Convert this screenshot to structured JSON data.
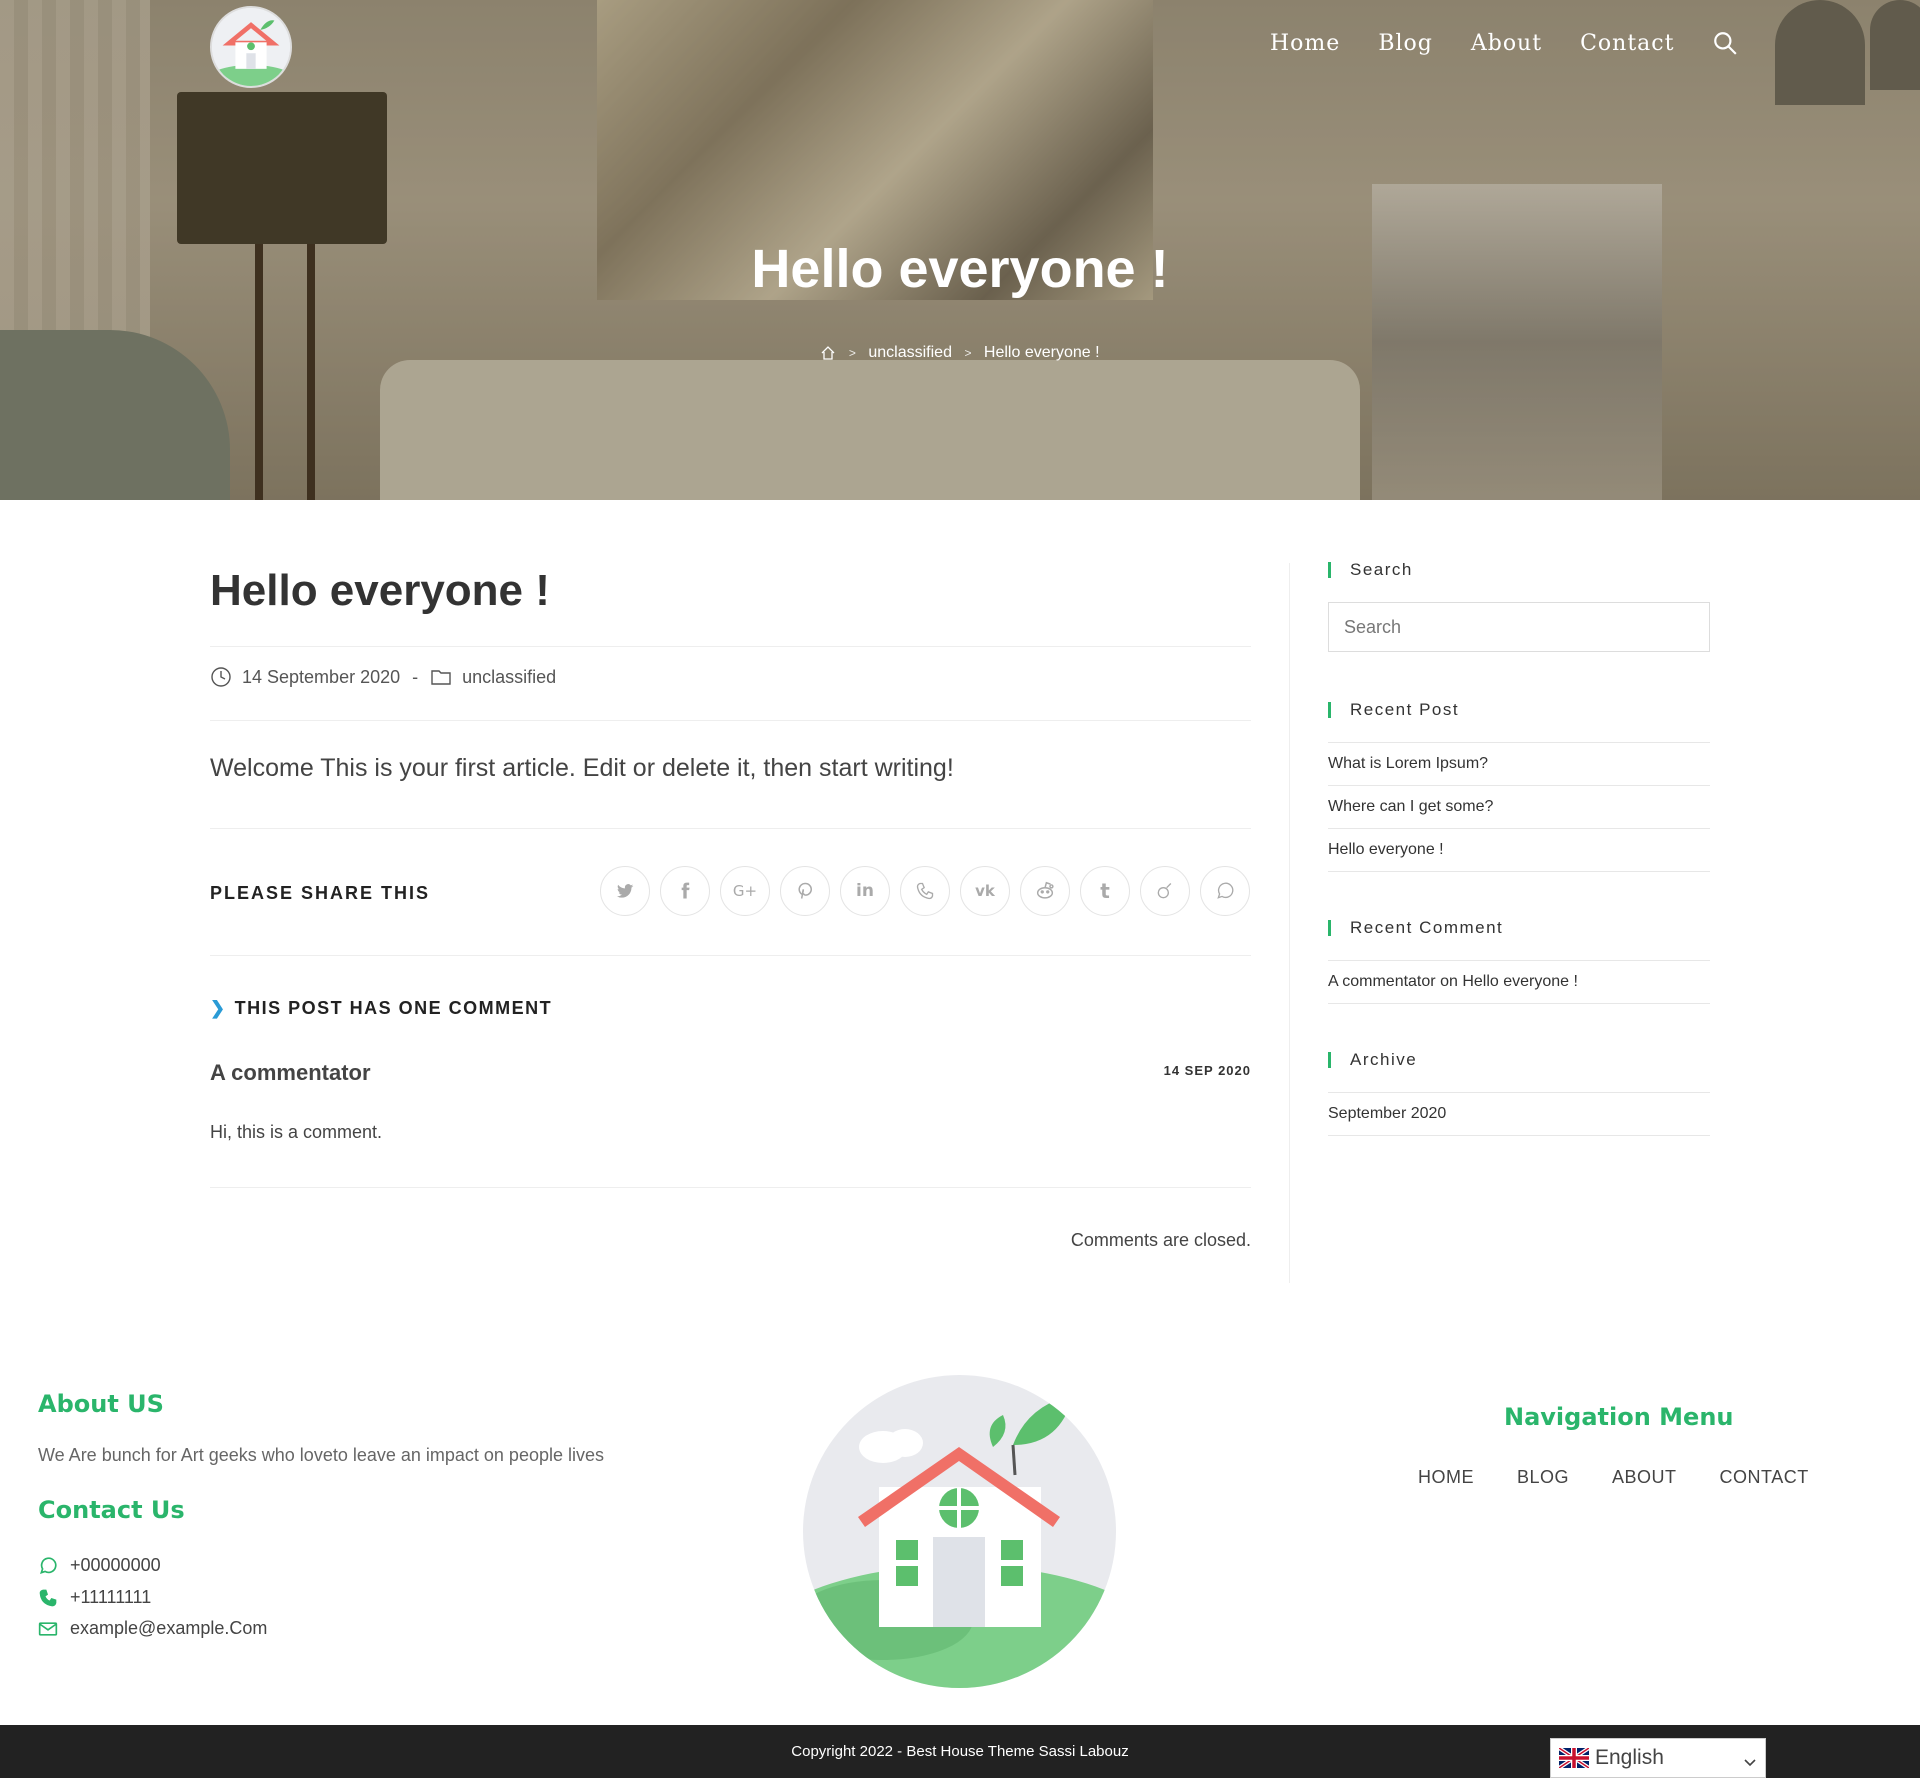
{
  "nav": {
    "items": [
      "Home",
      "Blog",
      "About",
      "Contact"
    ]
  },
  "hero": {
    "title": "Hello everyone !",
    "breadcrumb": {
      "category": "unclassified",
      "current": "Hello everyone !"
    }
  },
  "post": {
    "title": "Hello everyone !",
    "date": "14 September 2020",
    "category": "unclassified",
    "body": "Welcome This is your first article. Edit or delete it, then start writing!",
    "share_label": "PLEASE SHARE THIS",
    "share_icons": [
      "twitter-icon",
      "facebook-icon",
      "google-plus-icon",
      "pinterest-icon",
      "linkedin-icon",
      "viber-icon",
      "vk-icon",
      "reddit-icon",
      "tumblr-icon",
      "viadeo-icon",
      "whatsapp-icon"
    ],
    "comments_heading": "THIS POST HAS ONE COMMENT",
    "comment": {
      "author": "A commentator",
      "date": "14 SEP 2020",
      "text": "Hi, this is a comment."
    },
    "closed_text": "Comments are closed."
  },
  "sidebar": {
    "search_title": "Search",
    "search_placeholder": "Search",
    "recent_post_title": "Recent Post",
    "recent_posts": [
      "What is Lorem Ipsum?",
      "Where can I get some?",
      "Hello everyone !"
    ],
    "recent_comment_title": "Recent Comment",
    "recent_comment": {
      "author": "A commentator",
      "on": "on",
      "post": "Hello everyone !"
    },
    "archive_title": "Archive",
    "archives": [
      "September 2020"
    ]
  },
  "footer": {
    "about_title": "About US",
    "about_text": "We Are bunch for Art geeks who loveto leave an impact on people lives",
    "contact_title": "Contact Us",
    "whatsapp": "+00000000",
    "phone": "+11111111",
    "email": "example@example.Com",
    "nav_title": "Navigation Menu",
    "nav_items": [
      "HOME",
      "BLOG",
      "ABOUT",
      "CONTACT"
    ],
    "copyright": "Copyright 2022 - Best House Theme Sassi Labouz",
    "language": "English"
  },
  "colors": {
    "accent": "#2ab56b",
    "link_blue": "#2a9bd6",
    "footer_bar": "#222222"
  }
}
